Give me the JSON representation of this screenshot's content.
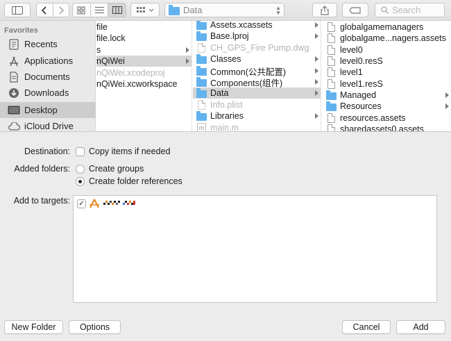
{
  "toolbar": {
    "path_label": "Data",
    "search_placeholder": "Search"
  },
  "sidebar": {
    "header": "Favorites",
    "items": [
      {
        "label": "Recents",
        "icon": "recents-icon"
      },
      {
        "label": "Applications",
        "icon": "applications-icon"
      },
      {
        "label": "Documents",
        "icon": "documents-icon"
      },
      {
        "label": "Downloads",
        "icon": "downloads-icon"
      },
      {
        "label": "Desktop",
        "icon": "desktop-icon",
        "selected": true
      },
      {
        "label": "iCloud Drive",
        "icon": "cloud-icon"
      }
    ]
  },
  "column1": {
    "items": [
      {
        "label": "file"
      },
      {
        "label": "file.lock"
      },
      {
        "label": "s",
        "arrow": true
      },
      {
        "label": "nQiWei",
        "arrow": true,
        "selected": true
      },
      {
        "label": "nQiWei.xcodeproj",
        "dim": true
      },
      {
        "label": "nQiWei.xcworkspace"
      }
    ]
  },
  "column2": {
    "items": [
      {
        "label": "Assets.xcassets",
        "kind": "folder",
        "arrow": true
      },
      {
        "label": "Base.lproj",
        "kind": "folder",
        "arrow": true
      },
      {
        "label": "CH_GPS_Fire Pump.dwg",
        "kind": "doc",
        "dim": true
      },
      {
        "label": "Classes",
        "kind": "folder",
        "arrow": true
      },
      {
        "label": "Common(公共配置)",
        "kind": "folder",
        "arrow": true
      },
      {
        "label": "Components(组件)",
        "kind": "folder",
        "arrow": true
      },
      {
        "label": "Data",
        "kind": "folder",
        "arrow": true,
        "selected": true
      },
      {
        "label": "Info.plist",
        "kind": "doc",
        "dim": true
      },
      {
        "label": "Libraries",
        "kind": "folder",
        "arrow": true
      },
      {
        "label": "main.m",
        "kind": "m",
        "dim": true
      }
    ]
  },
  "column3": {
    "items": [
      {
        "label": "globalgamemanagers",
        "kind": "doc"
      },
      {
        "label": "globalgame...nagers.assets",
        "kind": "doc"
      },
      {
        "label": "level0",
        "kind": "doc"
      },
      {
        "label": "level0.resS",
        "kind": "doc"
      },
      {
        "label": "level1",
        "kind": "doc"
      },
      {
        "label": "level1.resS",
        "kind": "doc"
      },
      {
        "label": "Managed",
        "kind": "folder",
        "arrow": true
      },
      {
        "label": "Resources",
        "kind": "folder",
        "arrow": true
      },
      {
        "label": "resources.assets",
        "kind": "doc"
      },
      {
        "label": "sharedassets0.assets",
        "kind": "doc"
      }
    ]
  },
  "options": {
    "destination_label": "Destination:",
    "copy_items_label": "Copy items if needed",
    "added_folders_label": "Added folders:",
    "create_groups_label": "Create groups",
    "create_folder_refs_label": "Create folder references",
    "add_to_targets_label": "Add to targets:",
    "target_checked_mark": "✓"
  },
  "buttons": {
    "new_folder": "New Folder",
    "options": "Options",
    "cancel": "Cancel",
    "add": "Add"
  },
  "colors": {
    "folder_blue": "#62b2ee",
    "selection_gray": "#d5d5d5"
  }
}
